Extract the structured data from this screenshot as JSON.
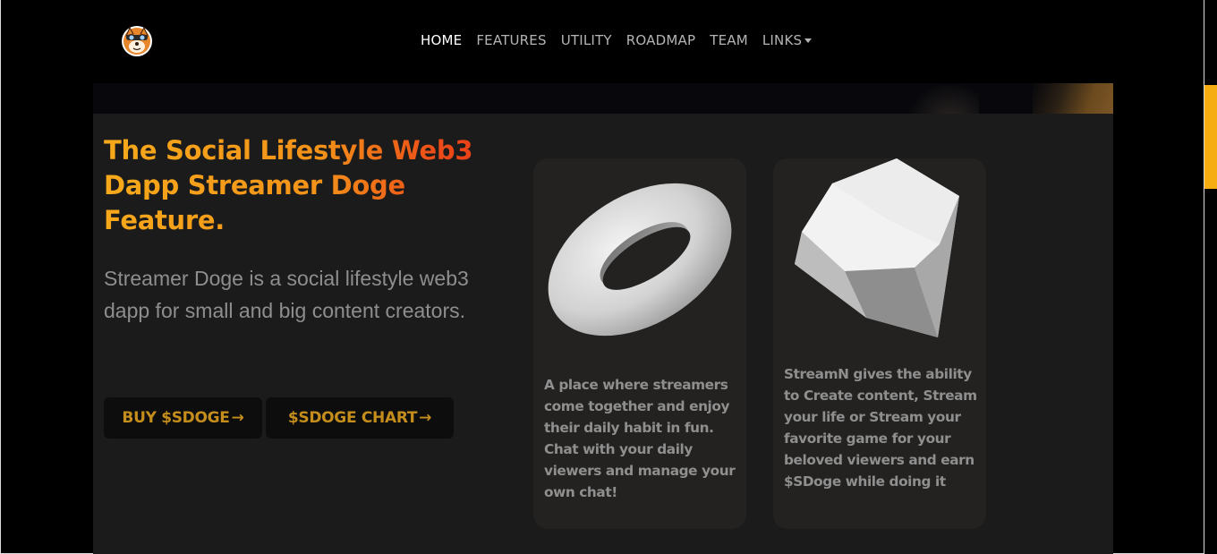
{
  "nav": {
    "logo_icon": "shiba-doge-logo",
    "items": [
      {
        "label": "HOME",
        "active": true
      },
      {
        "label": "FEATURES",
        "active": false
      },
      {
        "label": "UTILITY",
        "active": false
      },
      {
        "label": "ROADMAP",
        "active": false
      },
      {
        "label": "TEAM",
        "active": false
      },
      {
        "label": "LINKS",
        "active": false,
        "dropdown": true
      }
    ]
  },
  "hero": {
    "headline": "The Social Lifestyle Web3 Dapp Streamer Doge Feature.",
    "subtext": "Streamer Doge is a social lifestyle web3 dapp for small and big content creators.",
    "buy_button": "BUY $SDOGE",
    "chart_button": "$SDOGE CHART",
    "arrow_icon": "arrow-right-icon"
  },
  "cards": [
    {
      "icon": "torus-3d-icon",
      "text": "A place where streamers come together and enjoy their daily habit in fun. Chat with your daily viewers and manage your own chat!"
    },
    {
      "icon": "gem-3d-icon",
      "text": "StreamN gives the ability to Create content, Stream your life or Stream your favorite game for your beloved viewers and earn $SDoge while doing it"
    }
  ],
  "colors": {
    "accent": "#f5ad12",
    "headline_start": "#f6a91a",
    "headline_end": "#e63a17",
    "button_text": "#c48d1c",
    "background": "#000000",
    "section_bg": "#1b1b1b",
    "card_bg": "#232220"
  }
}
